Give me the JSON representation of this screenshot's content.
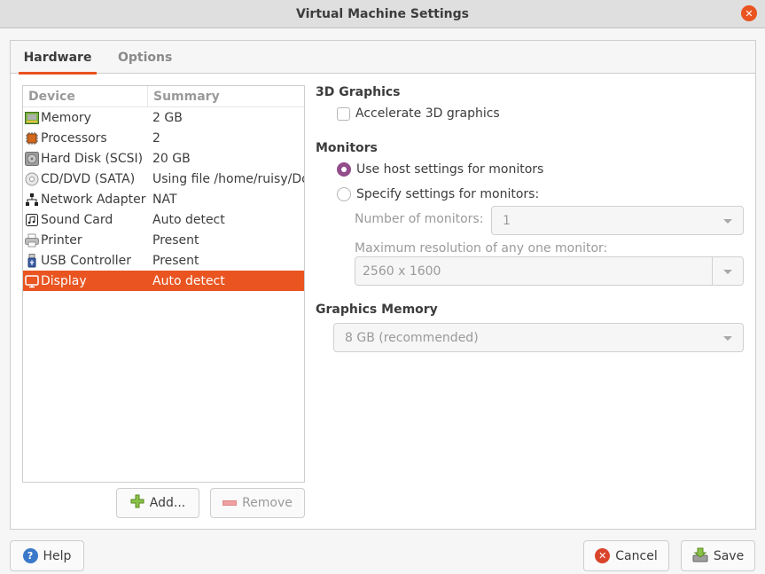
{
  "window": {
    "title": "Virtual Machine Settings",
    "close_icon": "close-icon"
  },
  "tabs": [
    {
      "label": "Hardware",
      "active": true
    },
    {
      "label": "Options",
      "active": false
    }
  ],
  "device_list": {
    "headers": {
      "device": "Device",
      "summary": "Summary"
    },
    "rows": [
      {
        "icon": "memory-icon",
        "device": "Memory",
        "summary": "2 GB"
      },
      {
        "icon": "processor-icon",
        "device": "Processors",
        "summary": "2"
      },
      {
        "icon": "hard-disk-icon",
        "device": "Hard Disk (SCSI)",
        "summary": "20 GB"
      },
      {
        "icon": "cd-dvd-icon",
        "device": "CD/DVD (SATA)",
        "summary": "Using file /home/ruisy/Dov"
      },
      {
        "icon": "network-icon",
        "device": "Network Adapter",
        "summary": "NAT"
      },
      {
        "icon": "sound-card-icon",
        "device": "Sound Card",
        "summary": "Auto detect"
      },
      {
        "icon": "printer-icon",
        "device": "Printer",
        "summary": "Present"
      },
      {
        "icon": "usb-icon",
        "device": "USB Controller",
        "summary": "Present"
      },
      {
        "icon": "display-icon",
        "device": "Display",
        "summary": "Auto detect",
        "selected": true
      }
    ],
    "add_label": "Add...",
    "remove_label": "Remove"
  },
  "display_settings": {
    "graphics3d": {
      "title": "3D Graphics",
      "accelerate_label": "Accelerate 3D graphics",
      "accelerate_checked": false
    },
    "monitors": {
      "title": "Monitors",
      "use_host_label": "Use host settings for monitors",
      "specify_label": "Specify settings for monitors:",
      "selected": "use_host",
      "num_monitors_label": "Number of monitors:",
      "num_monitors_value": "1",
      "max_res_label": "Maximum resolution of any one monitor:",
      "max_res_value": "2560 x 1600"
    },
    "graphics_memory": {
      "title": "Graphics Memory",
      "value": "8 GB (recommended)"
    }
  },
  "footer": {
    "help_label": "Help",
    "cancel_label": "Cancel",
    "save_label": "Save"
  },
  "colors": {
    "accent": "#e95420",
    "radio": "#924d8b"
  }
}
